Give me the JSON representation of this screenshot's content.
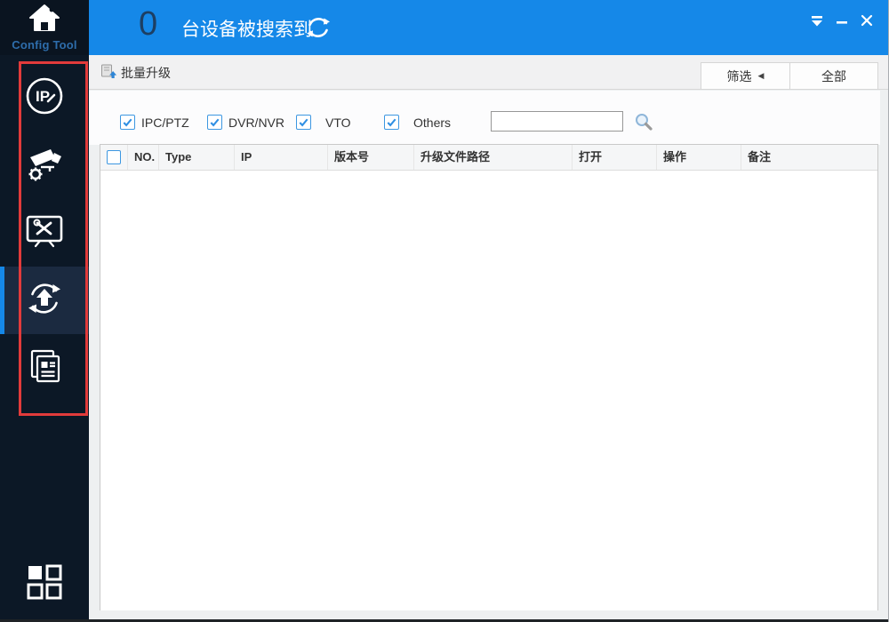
{
  "app": {
    "name": "Config Tool"
  },
  "header": {
    "device_count": "0",
    "device_count_label": "台设备被搜索到",
    "refresh_icon": "refresh-icon",
    "window_controls": {
      "collapse": "collapse-icon",
      "minimize": "minimize-icon",
      "close": "close-icon"
    }
  },
  "sidebar": {
    "items": [
      {
        "name": "modify-ip",
        "icon": "ip-edit-icon",
        "selected": false
      },
      {
        "name": "device-config",
        "icon": "camera-gear-icon",
        "selected": false
      },
      {
        "name": "system-settings",
        "icon": "monitor-tools-icon",
        "selected": false
      },
      {
        "name": "batch-upgrade",
        "icon": "upload-refresh-icon",
        "selected": true
      },
      {
        "name": "device-info",
        "icon": "document-icon",
        "selected": false
      }
    ],
    "launcher_icon": "grid-apps-icon"
  },
  "annotation": {
    "shape": "rectangle",
    "color": "#e23b3b",
    "purpose": "highlights sidebar tool icons"
  },
  "main": {
    "tab": {
      "title": "批量升级",
      "icon": "device-upload-icon"
    },
    "toolbar": {
      "filter_label": "筛选",
      "filter_arrow": "◀",
      "all_label": "全部"
    },
    "filters": [
      {
        "label": "IPC/PTZ",
        "checked": true
      },
      {
        "label": "DVR/NVR",
        "checked": true
      },
      {
        "label": "VTO",
        "checked": true
      },
      {
        "label": "Others",
        "checked": true
      }
    ],
    "search": {
      "value": "",
      "placeholder": "",
      "icon": "search-icon"
    },
    "table": {
      "select_all_checked": false,
      "columns": [
        "NO.",
        "Type",
        "IP",
        "版本号",
        "升级文件路径",
        "打开",
        "操作",
        "备注"
      ],
      "rows": []
    }
  },
  "colors": {
    "accent_blue": "#1588e8",
    "sidebar_bg": "#0c1826",
    "sidebar_selected_bg": "#1b2a40",
    "annotation_red": "#e23b3b",
    "count_text": "#1d3f63",
    "checkbox_blue": "#3d97e1"
  }
}
